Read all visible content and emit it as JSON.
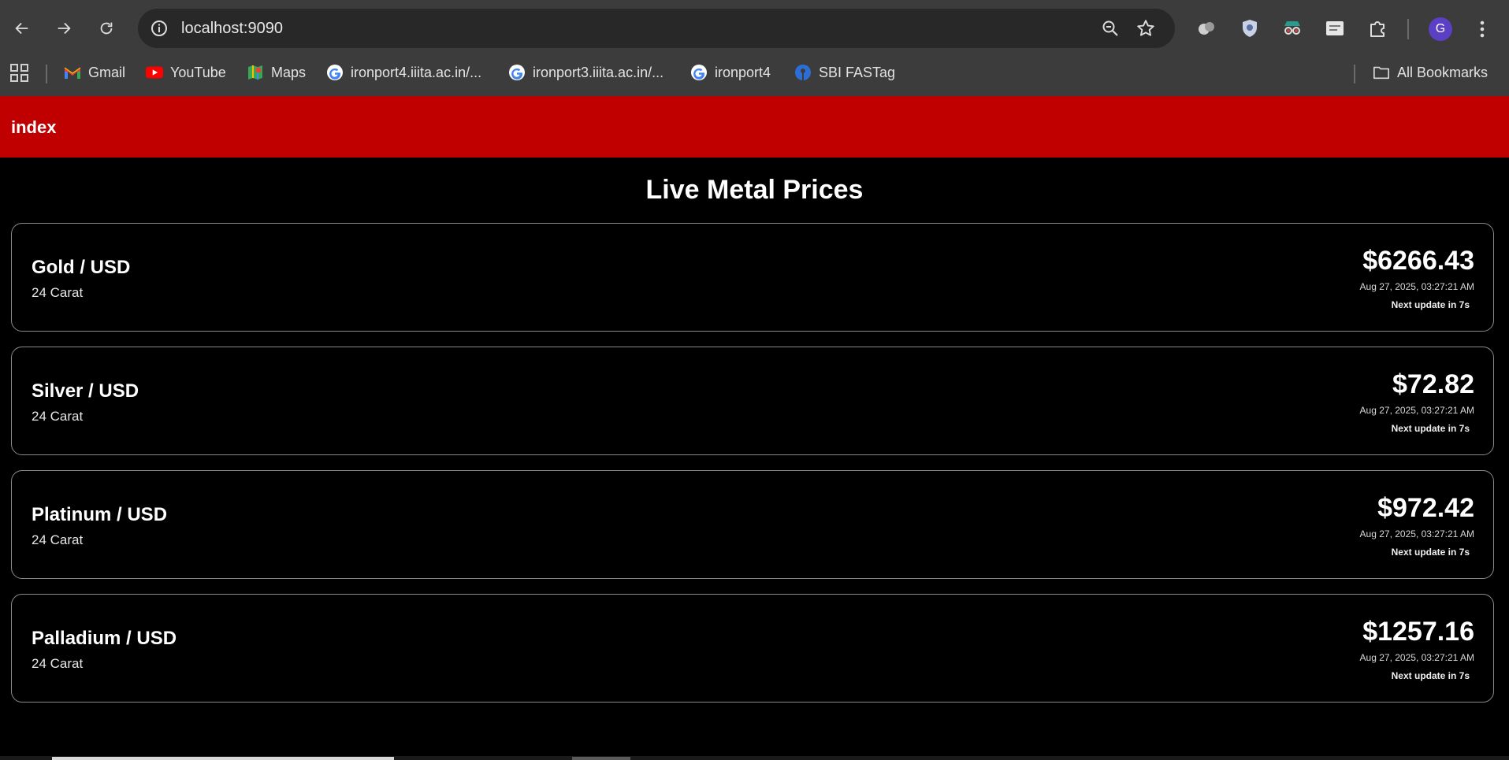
{
  "browser": {
    "url": "localhost:9090",
    "profile_initial": "G",
    "bookmarks": [
      {
        "label": "Gmail",
        "icon": "gmail-icon"
      },
      {
        "label": "YouTube",
        "icon": "youtube-icon"
      },
      {
        "label": "Maps",
        "icon": "maps-icon"
      },
      {
        "label": "ironport4.iiita.ac.in/...",
        "icon": "google-icon"
      },
      {
        "label": "ironport3.iiita.ac.in/...",
        "icon": "google-icon"
      },
      {
        "label": "ironport4",
        "icon": "google-icon"
      },
      {
        "label": "SBI FASTag",
        "icon": "sbi-icon"
      }
    ],
    "all_bookmarks_label": "All Bookmarks"
  },
  "header": {
    "brand": "index",
    "color": "#c00000"
  },
  "page": {
    "title": "Live Metal Prices"
  },
  "prices": [
    {
      "name": "Gold / USD",
      "purity": "24 Carat",
      "price": "$6266.43",
      "timestamp": "Aug 27, 2025, 03:27:21 AM",
      "next_update": "Next update in 7s"
    },
    {
      "name": "Silver / USD",
      "purity": "24 Carat",
      "price": "$72.82",
      "timestamp": "Aug 27, 2025, 03:27:21 AM",
      "next_update": "Next update in 7s"
    },
    {
      "name": "Platinum / USD",
      "purity": "24 Carat",
      "price": "$972.42",
      "timestamp": "Aug 27, 2025, 03:27:21 AM",
      "next_update": "Next update in 7s"
    },
    {
      "name": "Palladium / USD",
      "purity": "24 Carat",
      "price": "$1257.16",
      "timestamp": "Aug 27, 2025, 03:27:21 AM",
      "next_update": "Next update in 7s"
    }
  ]
}
